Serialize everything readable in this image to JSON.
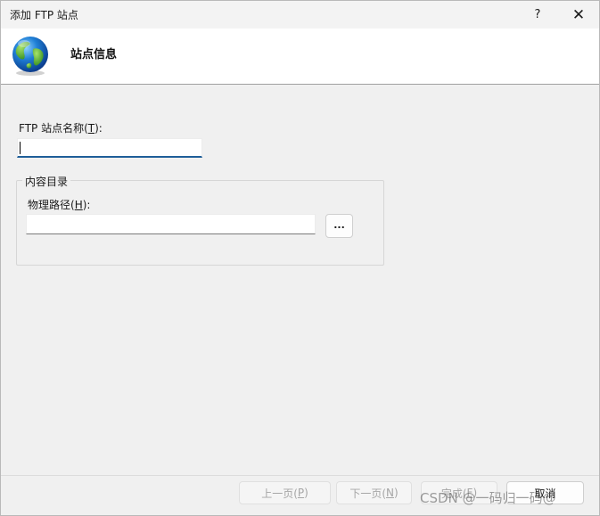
{
  "window": {
    "title": "添加 FTP 站点",
    "help_glyph": "?",
    "close_glyph": "✕"
  },
  "header": {
    "title": "站点信息",
    "icon": "globe-icon"
  },
  "site_name": {
    "label_prefix": "FTP 站点名称(",
    "label_key": "T",
    "label_suffix": "):",
    "value": ""
  },
  "content_directory": {
    "legend": "内容目录",
    "physical_path": {
      "label_prefix": "物理路径(",
      "label_key": "H",
      "label_suffix": "):",
      "value": ""
    },
    "browse_label": "..."
  },
  "footer": {
    "prev": {
      "prefix": "上一页(",
      "key": "P",
      "suffix": ")",
      "enabled": false
    },
    "next": {
      "prefix": "下一页(",
      "key": "N",
      "suffix": ")",
      "enabled": false
    },
    "finish": {
      "prefix": "完成(",
      "key": "F",
      "suffix": ")",
      "enabled": false
    },
    "cancel": {
      "label": "取消",
      "enabled": true
    }
  },
  "watermark": "CSDN @一码归一码@"
}
